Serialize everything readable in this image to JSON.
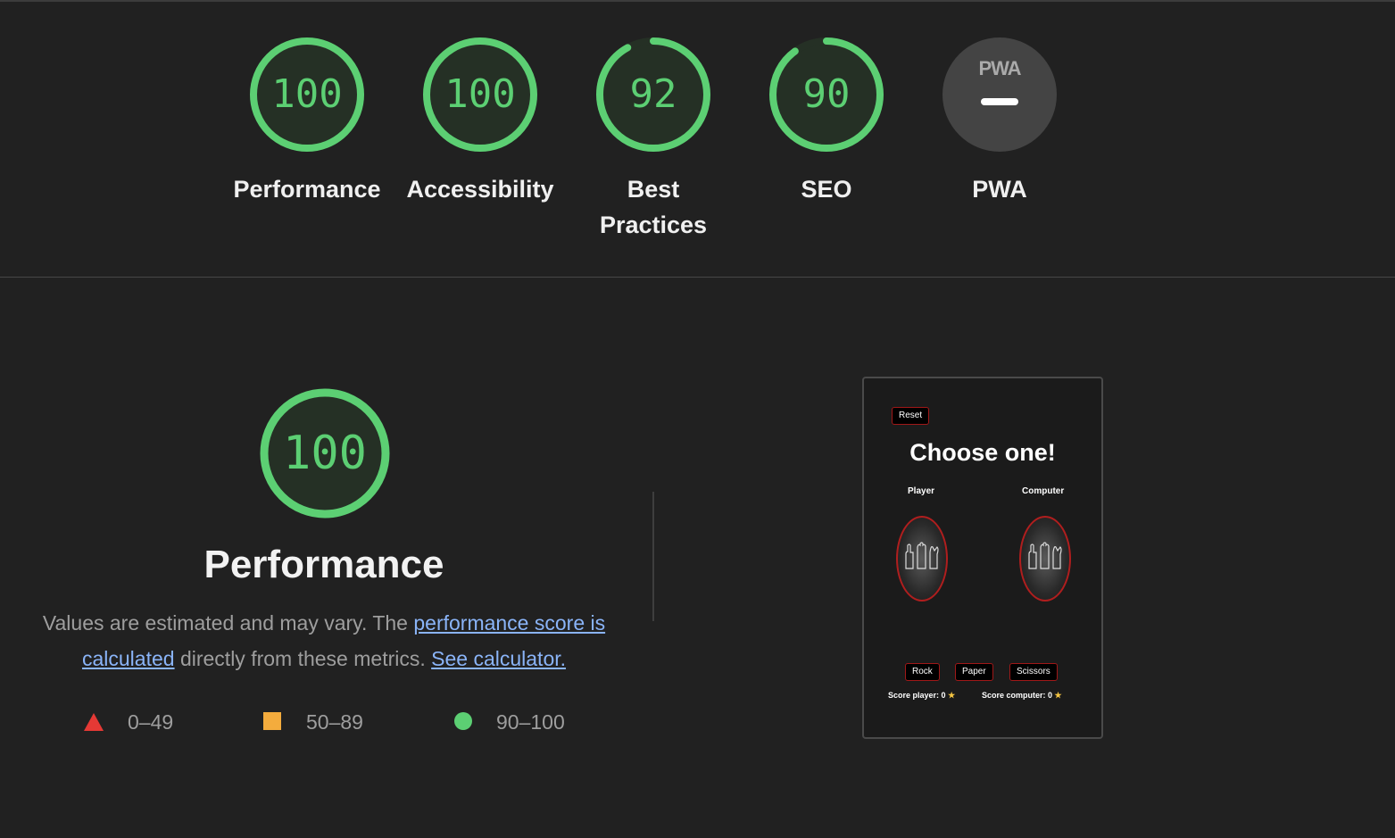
{
  "gauges": [
    {
      "label": "Performance",
      "score": "100",
      "value": 100
    },
    {
      "label": "Accessibility",
      "score": "100",
      "value": 100
    },
    {
      "label_line1": "Best",
      "label_line2": "Practices",
      "score": "92",
      "value": 92
    },
    {
      "label": "SEO",
      "score": "90",
      "value": 90
    },
    {
      "label": "PWA",
      "logo": "PWA",
      "score": "–"
    }
  ],
  "performance": {
    "score": "100",
    "title": "Performance",
    "desc_before": "Values are estimated and may vary. The ",
    "link_score": "performance score is calculated",
    "desc_middle": " directly from these metrics. ",
    "link_calc": "See calculator."
  },
  "legend": {
    "fail": "0–49",
    "average": "50–89",
    "pass": "90–100"
  },
  "colors": {
    "pass": "#5ccf73",
    "average": "#f4ac3d",
    "fail": "#e53935",
    "link": "#8ab4f8"
  },
  "screenshot": {
    "reset": "Reset",
    "title": "Choose one!",
    "player_label": "Player",
    "computer_label": "Computer",
    "rock": "Rock",
    "paper": "Paper",
    "scissors": "Scissors",
    "score_player": "Score player: 0",
    "score_computer": "Score computer: 0",
    "star": "★"
  }
}
